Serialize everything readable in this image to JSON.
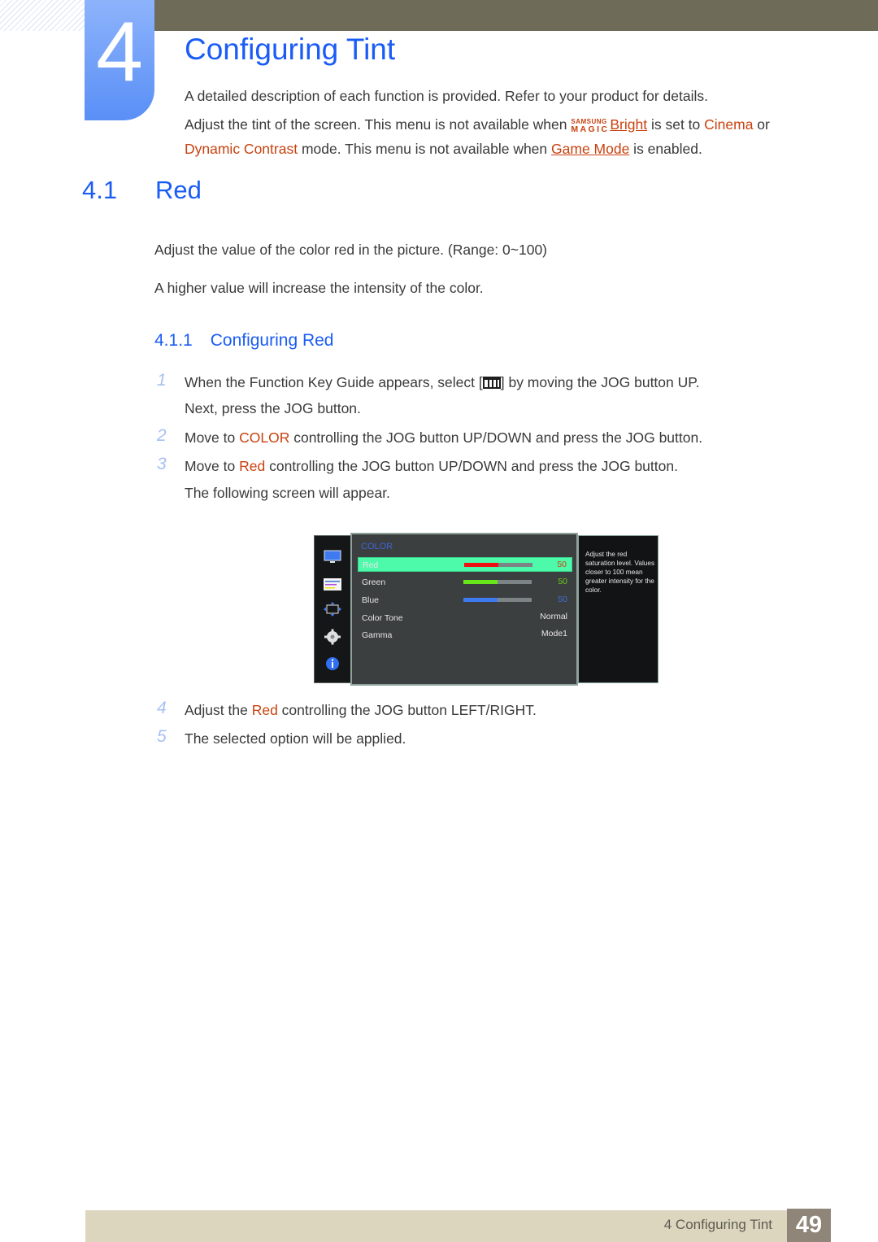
{
  "chapter": {
    "number": "4",
    "title": "Configuring Tint"
  },
  "intro": {
    "line1": "A detailed description of each function is provided. Refer to your product for details.",
    "line2_a": "Adjust the tint of the screen. This menu is not available when ",
    "magic_top": "SAMSUNG",
    "magic_bottom": "MAGIC",
    "bright_link": "Bright",
    "line2_b": " is set to ",
    "cinema": "Cinema",
    "line2_c": " or",
    "dynamic_contrast": "Dynamic Contrast",
    "line3_a": " mode. This menu is not available when ",
    "game_mode_link": "Game Mode",
    "line3_b": " is enabled."
  },
  "section": {
    "number": "4.1",
    "title": "Red",
    "para1": "Adjust the value of the color red in the picture. (Range: 0~100)",
    "para2": "A higher value will increase the intensity of the color."
  },
  "subsection": {
    "number": "4.1.1",
    "title": "Configuring Red"
  },
  "steps": [
    {
      "num": "1",
      "a": "When the Function Key Guide appears, select [",
      "icon": "menu-key-icon",
      "b": "] by moving the JOG button UP.",
      "line2": "Next, press the JOG button."
    },
    {
      "num": "2",
      "a": "Move to ",
      "hl": "COLOR",
      "b": " controlling the JOG button UP/DOWN and press the JOG button."
    },
    {
      "num": "3",
      "a": "Move to ",
      "hl": "Red",
      "b": " controlling the JOG button UP/DOWN and press the JOG button.",
      "line2": "The following screen will appear."
    },
    {
      "num": "4",
      "a": "Adjust the ",
      "hl": "Red",
      "b": " controlling the JOG button LEFT/RIGHT."
    },
    {
      "num": "5",
      "a": "The selected option will be applied."
    }
  ],
  "osd": {
    "side_icons": [
      "picture-icon",
      "color-icon",
      "size-position-icon",
      "setup-icon",
      "info-icon"
    ],
    "heading": "COLOR",
    "rows": [
      {
        "label": "Red",
        "value": "50",
        "level": 0.5,
        "bar_color": "#ee1111",
        "value_color": "#c9420f",
        "selected": true
      },
      {
        "label": "Green",
        "value": "50",
        "level": 0.5,
        "bar_color": "#66e619",
        "value_color": "#66cc19",
        "selected": false
      },
      {
        "label": "Blue",
        "value": "50",
        "level": 0.5,
        "bar_color": "#3f7bf0",
        "value_color": "#3f6fd9",
        "selected": false
      },
      {
        "label": "Color Tone",
        "text_value": "Normal"
      },
      {
        "label": "Gamma",
        "text_value": "Mode1"
      }
    ],
    "help_text": "Adjust the red saturation level. Values closer to 100 mean greater intensity for the color."
  },
  "footer": {
    "label": "4 Configuring Tint",
    "page": "49"
  },
  "colors": {
    "heading_blue": "#1a5cf5",
    "highlight_orange": "#c9420f",
    "step_number": "#a6c0f4"
  }
}
